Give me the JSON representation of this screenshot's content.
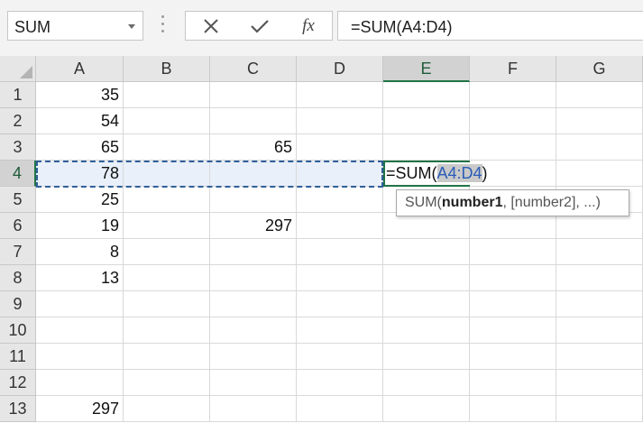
{
  "formula_bar": {
    "name_box": "SUM",
    "cancel_icon": "close-icon",
    "enter_icon": "checkmark-icon",
    "fx_label": "fx",
    "formula": "=SUM(A4:D4)"
  },
  "columns": [
    "A",
    "B",
    "C",
    "D",
    "E",
    "F",
    "G"
  ],
  "selected_column": "E",
  "selected_row": "4",
  "rows": [
    {
      "label": "1",
      "cells": [
        "35",
        "",
        "",
        "",
        "",
        "",
        ""
      ]
    },
    {
      "label": "2",
      "cells": [
        "54",
        "",
        "",
        "",
        "",
        "",
        ""
      ]
    },
    {
      "label": "3",
      "cells": [
        "65",
        "",
        "65",
        "",
        "",
        "",
        ""
      ]
    },
    {
      "label": "4",
      "cells": [
        "78",
        "",
        "",
        "",
        "",
        "",
        ""
      ]
    },
    {
      "label": "5",
      "cells": [
        "25",
        "",
        "",
        "",
        "",
        "",
        ""
      ]
    },
    {
      "label": "6",
      "cells": [
        "19",
        "",
        "297",
        "",
        "",
        "",
        ""
      ]
    },
    {
      "label": "7",
      "cells": [
        "8",
        "",
        "",
        "",
        "",
        "",
        ""
      ]
    },
    {
      "label": "8",
      "cells": [
        "13",
        "",
        "",
        "",
        "",
        "",
        ""
      ]
    },
    {
      "label": "9",
      "cells": [
        "",
        "",
        "",
        "",
        "",
        "",
        ""
      ]
    },
    {
      "label": "10",
      "cells": [
        "",
        "",
        "",
        "",
        "",
        "",
        ""
      ]
    },
    {
      "label": "11",
      "cells": [
        "",
        "",
        "",
        "",
        "",
        "",
        ""
      ]
    },
    {
      "label": "12",
      "cells": [
        "",
        "",
        "",
        "",
        "",
        "",
        ""
      ]
    },
    {
      "label": "13",
      "cells": [
        "297",
        "",
        "",
        "",
        "",
        "",
        ""
      ]
    }
  ],
  "editing_cell": {
    "prefix": "=SUM(",
    "reference": "A4:D4",
    "suffix": ")"
  },
  "tooltip": {
    "func": "SUM(",
    "arg_bold": "number1",
    "rest": ", [number2], ...)"
  },
  "colors": {
    "accent_green": "#217346",
    "reference_blue": "#2a5cb8",
    "range_fill": "#e9f0fa"
  }
}
